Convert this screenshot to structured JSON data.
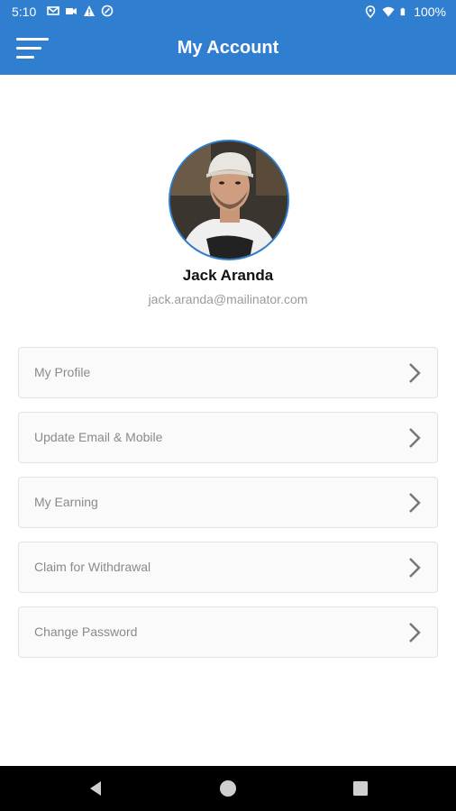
{
  "status_bar": {
    "time": "5:10",
    "battery": "100%",
    "left_icons": [
      "mail-icon",
      "video-icon",
      "warning-icon",
      "sync-icon"
    ],
    "right_icons": [
      "location-icon",
      "wifi-icon",
      "battery-icon"
    ]
  },
  "header": {
    "title": "My Account",
    "menu_icon": "hamburger-menu-icon",
    "color": "#2f7ed0"
  },
  "profile": {
    "name": "Jack Aranda",
    "email": "jack.aranda@mailinator.com"
  },
  "menu": {
    "items": [
      {
        "label": "My Profile"
      },
      {
        "label": "Update Email & Mobile"
      },
      {
        "label": "My Earning"
      },
      {
        "label": "Claim for Withdrawal"
      },
      {
        "label": "Change Password"
      }
    ],
    "chevron_icon": "chevron-right-icon"
  },
  "nav_bar": {
    "buttons": [
      "back-icon",
      "home-icon",
      "recents-icon"
    ]
  }
}
